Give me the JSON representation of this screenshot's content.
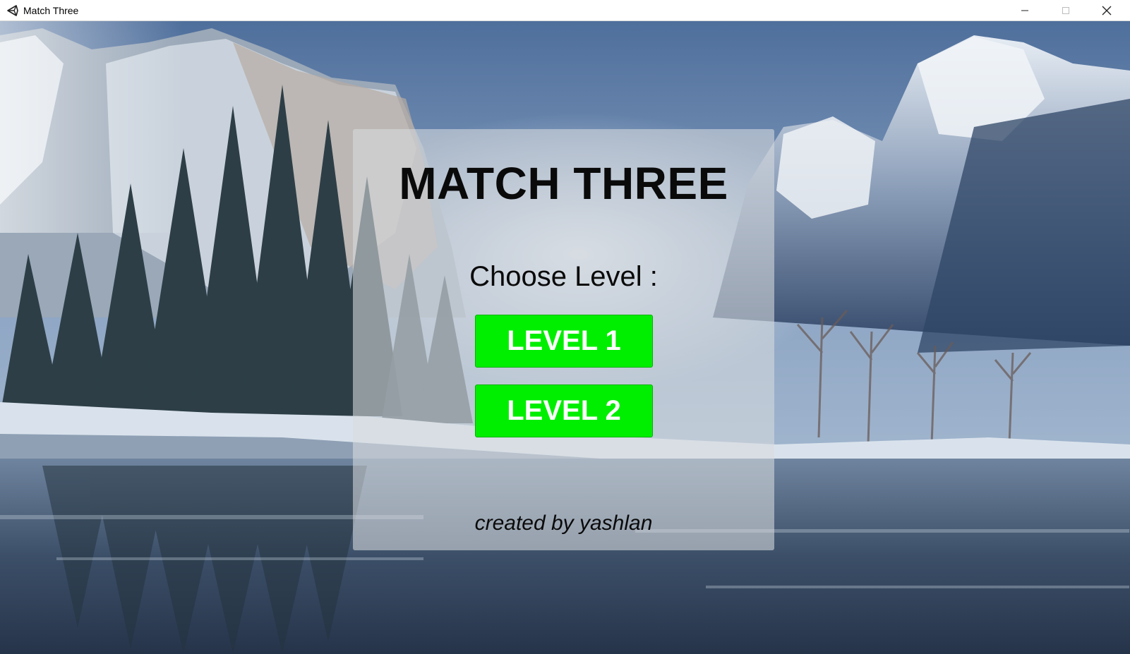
{
  "window": {
    "title": "Match Three",
    "icon": "unity-logo-icon",
    "controls": [
      "minimize-icon",
      "maximize-icon",
      "close-icon"
    ]
  },
  "menu": {
    "title": "MATCH THREE",
    "choose_label": "Choose Level :",
    "buttons": [
      {
        "label": "LEVEL 1"
      },
      {
        "label": "LEVEL 2"
      }
    ],
    "credits": "created by yashlan"
  },
  "colors": {
    "button_fill": "#00ee00",
    "button_text": "#ffffff",
    "title_text": "#0a0a0a",
    "panel": "rgba(215,218,222,0.58)"
  }
}
